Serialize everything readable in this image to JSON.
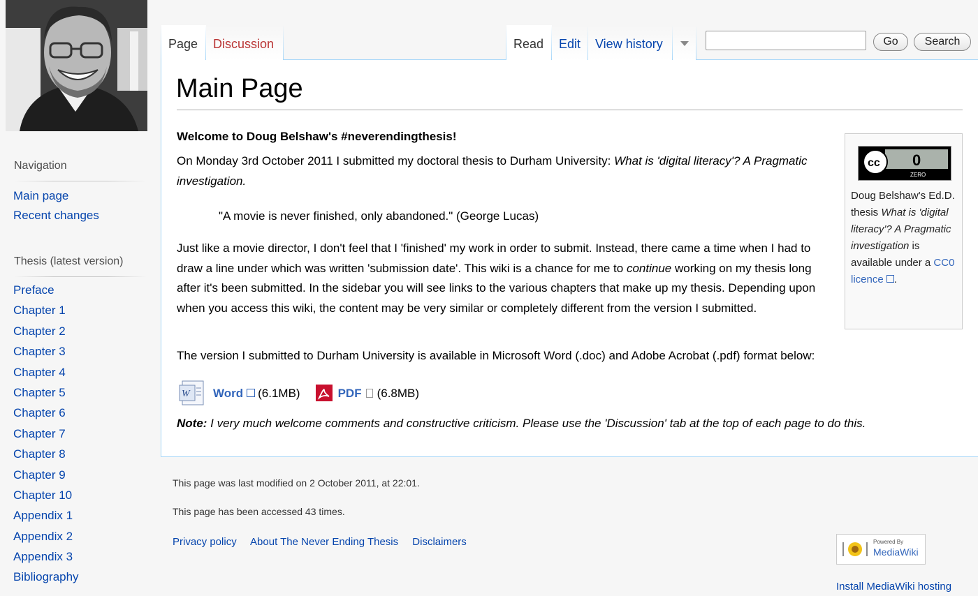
{
  "tabs": {
    "page": "Page",
    "discussion": "Discussion",
    "read": "Read",
    "edit": "Edit",
    "view_history": "View history"
  },
  "search": {
    "value": "",
    "go_label": "Go",
    "search_label": "Search"
  },
  "sidebar": {
    "navigation_heading": "Navigation",
    "navigation_items": [
      "Main page",
      "Recent changes"
    ],
    "thesis_heading": "Thesis (latest version)",
    "thesis_items": [
      "Preface",
      "Chapter 1",
      "Chapter 2",
      "Chapter 3",
      "Chapter 4",
      "Chapter 5",
      "Chapter 6",
      "Chapter 7",
      "Chapter 8",
      "Chapter 9",
      "Chapter 10",
      "Appendix 1",
      "Appendix 2",
      "Appendix 3",
      "Bibliography"
    ]
  },
  "content": {
    "title": "Main Page",
    "welcome": "Welcome to Doug Belshaw's #neverendingthesis!",
    "intro_prefix": "On Monday 3rd October 2011 I submitted my doctoral thesis to Durham University: ",
    "thesis_title": "What is 'digital literacy'? A Pragmatic investigation.",
    "quote": "\"A movie is never finished, only abandoned.\" (George Lucas)",
    "body_part1": "Just like a movie director, I don't feel that I 'finished' my work in order to submit. Instead, there came a time when I had to draw a line under which was written 'submission date'. This wiki is a chance for me to ",
    "body_emphasis": "continue",
    "body_part2": " working on my thesis long after it's been submitted. In the sidebar you will see links to the various chapters that make up my thesis. Depending upon when you access this wiki, the content may be very similar or completely different from the version I submitted.",
    "version_line": "The version I submitted to Durham University is available in Microsoft Word (.doc) and Adobe Acrobat (.pdf) format below:",
    "word_link": "Word",
    "word_size": "(6.1MB)",
    "pdf_link": "PDF",
    "pdf_size": "(6.8MB)",
    "note_label": "Note:",
    "note_text": " I very much welcome comments and constructive criticism. Please use the 'Discussion' tab at the top of each page to do this."
  },
  "licence": {
    "cc_label": "cc",
    "zero_digit": "0",
    "zero_word": "ZERO",
    "text_prefix": "Doug Belshaw's Ed.D. thesis ",
    "text_title": "What is 'digital literacy'? A Pragmatic investigation",
    "text_middle": " is available under a ",
    "link": "CC0 licence",
    "text_suffix": "."
  },
  "footer": {
    "last_modified": "This page was last modified on 2 October 2011, at 22:01.",
    "accessed": "This page has been accessed 43 times.",
    "links": [
      "Privacy policy",
      "About The Never Ending Thesis",
      "Disclaimers"
    ],
    "powered_small": "Powered By",
    "powered_big": "MediaWiki",
    "install_text": "Install MediaWiki  hosting"
  },
  "colors": {
    "link": "#0645ad",
    "new_link": "#ba3535",
    "border_blue": "#a7d7f9",
    "page_bg": "#f6f6f6"
  },
  "icons": [
    "user-photo-logo",
    "tab-dropdown-arrow-icon",
    "external-link-icon",
    "word-document-icon",
    "pdf-icon",
    "file-icon",
    "cc-zero-badge",
    "mediawiki-logo-icon"
  ]
}
